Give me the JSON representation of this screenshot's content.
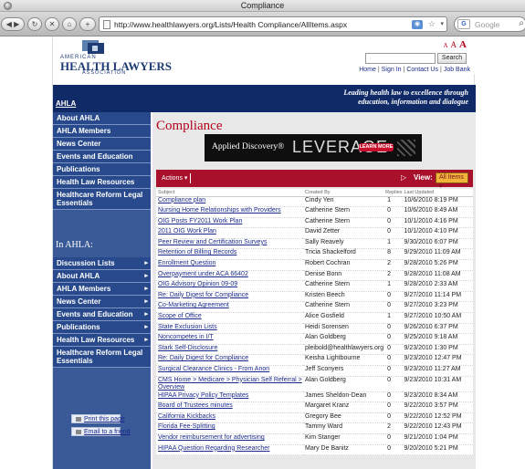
{
  "window": {
    "title": "Compliance"
  },
  "browser": {
    "url": "http://www.healthlawyers.org/Lists/Health Compliance/AllItems.aspx",
    "search_placeholder": "Google",
    "rss_label": "RSS"
  },
  "header": {
    "logo_line1": "AMERICAN",
    "logo_line2": "HEALTH LAWYERS",
    "logo_line3": "ASSOCIATION",
    "text_size_small": "A",
    "text_size_medium": "A",
    "text_size_large": "A",
    "search_button": "Search",
    "search_value": "",
    "links": [
      "Home",
      "Sign In",
      "Contact Us",
      "Job Bank"
    ]
  },
  "banner": {
    "ahla_link": "AHLA",
    "tagline_line1": "Leading health law to excellence through",
    "tagline_line2": "education, information and dialogue"
  },
  "sidebar": {
    "top_items": [
      "About AHLA",
      "AHLA Members",
      "News Center",
      "Events and Education",
      "Publications",
      "Health Law Resources",
      "Healthcare Reform Legal Essentials"
    ],
    "in_ahla_heading": "In AHLA:",
    "sub_items": [
      "Discussion Lists",
      "About AHLA",
      "AHLA Members",
      "News Center",
      "Events and Education",
      "Publications",
      "Health Law Resources",
      "Healthcare Reform Legal Essentials"
    ],
    "print_label": "Print this page",
    "email_label": "Email to a friend"
  },
  "main": {
    "title": "Compliance",
    "ad": {
      "brand": "Applied Discovery®",
      "product": "LEVERAGE",
      "cta": "LEARN MORE"
    },
    "list": {
      "actions_label": "Actions",
      "page_indicator": "1",
      "view_label": "View:",
      "view_value": "All Items",
      "columns": [
        "Subject",
        "Created By",
        "Replies",
        "Last Updated"
      ],
      "rows": [
        [
          "Compliance plan",
          "Cindy Yen",
          "1",
          "10/6/2010 8:19 PM"
        ],
        [
          "Nursing Home Relationships with Providers",
          "Catherine Stern",
          "0",
          "10/6/2010 8:49 AM"
        ],
        [
          "OIG Posts FY2011 Work Plan",
          "Catherine Stern",
          "0",
          "10/1/2010 4:16 PM"
        ],
        [
          "2011 OIG Work Plan",
          "David Zetter",
          "0",
          "10/1/2010 4:10 PM"
        ],
        [
          "Peer Review and Certification Surveys",
          "Sally Reavely",
          "1",
          "9/30/2010 6:07 PM"
        ],
        [
          "Retention of Billing Records",
          "Tricia Shackelford",
          "8",
          "9/29/2010 11:09 AM"
        ],
        [
          "Enrollment Question",
          "Robert Cochran",
          "2",
          "9/28/2010 5:26 PM"
        ],
        [
          "Overpayment under ACA 66402",
          "Denise Bonn",
          "2",
          "9/28/2010 11:08 AM"
        ],
        [
          "OIG Advisory Opinion 09-09",
          "Catherine Stern",
          "1",
          "9/28/2010 2:33 AM"
        ],
        [
          "Re: Daily Digest for Compliance",
          "Kristen Beech",
          "0",
          "9/27/2010 11:14 PM"
        ],
        [
          "Co-Marketing Agreement",
          "Catherine Stern",
          "0",
          "9/27/2010 3:23 PM"
        ],
        [
          "Scope of Office",
          "Alice Gosfield",
          "1",
          "9/27/2010 10:50 AM"
        ],
        [
          "State Exclusion Lists",
          "Heidi Sorensen",
          "0",
          "9/26/2010 6:37 PM"
        ],
        [
          "Noncompetes in I/T",
          "Alan Goldberg",
          "0",
          "9/25/2010 9:18 AM"
        ],
        [
          "Stark Self-Disclosure",
          "pleibold@healthlawyers.org",
          "0",
          "9/23/2010 1:30 PM"
        ],
        [
          "Re: Daily Digest for Compliance",
          "Keisha Lightbourne",
          "0",
          "9/23/2010 12:47 PM"
        ],
        [
          "Surgical Clearance Clinics - From Anon",
          "Jeff Sconyers",
          "0",
          "9/23/2010 11:27 AM"
        ],
        [
          "CMS Home > Medicare > Physician Self Referral > Overview",
          "Alan Goldberg",
          "0",
          "9/23/2010 10:31 AM"
        ],
        [
          "HIPAA Privacy Policy Templates",
          "James Sheldon-Dean",
          "0",
          "9/23/2010 8:34 AM"
        ],
        [
          "Board of Trustees minutes",
          "Margaret Kranz",
          "0",
          "9/22/2010 3:57 PM"
        ],
        [
          "California Kickbacks",
          "Gregory Bee",
          "0",
          "9/22/2010 12:52 PM"
        ],
        [
          "Florida Fee-Splitting",
          "Tammy Ward",
          "2",
          "9/22/2010 12:43 PM"
        ],
        [
          "Vendor reimbursement for advertising",
          "Kim Stanger",
          "0",
          "9/21/2010 1:04 PM"
        ],
        [
          "HIPAA Question Regarding Researcher",
          "Mary De Banitz",
          "0",
          "9/20/2010 5:21 PM"
        ]
      ]
    }
  }
}
